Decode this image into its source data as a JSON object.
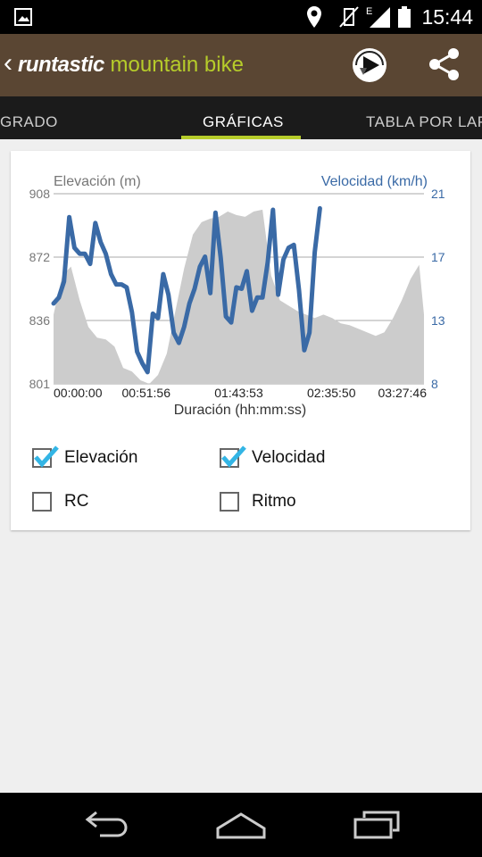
{
  "status_bar": {
    "time": "15:44",
    "icons": [
      "image-icon",
      "location-icon",
      "vibrate-off-icon",
      "signal-e-icon",
      "battery-icon"
    ]
  },
  "app_bar": {
    "back_glyph": "‹",
    "brand_part1": "runtastic",
    "brand_part2": "mountain bike",
    "actions": [
      "play-icon",
      "share-icon"
    ]
  },
  "tabs": [
    {
      "label": "GRADO"
    },
    {
      "label": "GRÁFICAS",
      "active": true
    },
    {
      "label": "TABLA POR LAP"
    }
  ],
  "chart_data": {
    "type": "area+line",
    "left_axis_title": "Elevación (m)",
    "right_axis_title": "Velocidad (km/h)",
    "x_axis_title": "Duración (hh:mm:ss)",
    "y_left_ticks": [
      "908",
      "872",
      "836",
      "801"
    ],
    "y_right_ticks": [
      "21",
      "17",
      "13",
      "8"
    ],
    "x_ticks": [
      "00:00:00",
      "00:51:56",
      "01:43:53",
      "02:35:50",
      "03:27:46"
    ],
    "y_left_range": [
      801,
      908
    ],
    "y_right_range": [
      8,
      21
    ],
    "x_range_minutes": [
      0,
      212.75
    ],
    "colors": {
      "elevation_fill": "#cccccc",
      "speed_line": "#3a6aa6",
      "left_axis_text": "#777777",
      "right_axis_text": "#3a6aa6"
    },
    "series": [
      {
        "name": "Elevación",
        "unit": "m",
        "x_min": [
          0,
          5,
          10,
          15,
          20,
          25,
          30,
          35,
          40,
          45,
          50,
          55,
          60,
          65,
          70,
          75,
          80,
          85,
          90,
          95,
          100,
          105,
          110,
          115,
          120,
          125,
          130,
          135,
          140,
          145,
          150,
          155,
          160,
          165,
          170,
          175,
          180,
          185,
          190,
          195,
          200,
          205,
          210,
          212.75
        ],
        "values": [
          840,
          862,
          867,
          848,
          833,
          827,
          826,
          822,
          810,
          808,
          803,
          801,
          806,
          818,
          842,
          866,
          885,
          892,
          894,
          895,
          898,
          896,
          895,
          898,
          899,
          862,
          848,
          845,
          842,
          840,
          838,
          840,
          838,
          835,
          834,
          832,
          830,
          828,
          830,
          838,
          848,
          860,
          868,
          840
        ]
      },
      {
        "name": "Velocidad",
        "unit": "km/h",
        "x_min": [
          0,
          3,
          6,
          9,
          12,
          15,
          18,
          21,
          24,
          27,
          30,
          33,
          36,
          39,
          42,
          45,
          48,
          51,
          54,
          57,
          60,
          63,
          66,
          69,
          72,
          75,
          78,
          81,
          84,
          87,
          90,
          93,
          96,
          99,
          102,
          105,
          108,
          111,
          114,
          117,
          120,
          123,
          126,
          129,
          132,
          135,
          138,
          141,
          144,
          147,
          150,
          153,
          156,
          159,
          162,
          165,
          168,
          171,
          174,
          177,
          180,
          183,
          186,
          189,
          192,
          195,
          198,
          201,
          204,
          207,
          210,
          212.75
        ],
        "values": [
          13.5,
          13.9,
          15.0,
          19.4,
          17.3,
          16.9,
          16.9,
          16.2,
          19.0,
          17.7,
          16.9,
          15.5,
          14.8,
          14.8,
          14.6,
          12.9,
          10.2,
          9.4,
          8.8,
          12.8,
          12.5,
          15.5,
          14.1,
          11.5,
          10.8,
          11.9,
          13.5,
          14.5,
          16.0,
          16.7,
          14.2,
          19.7,
          16.6,
          12.6,
          12.2,
          14.6,
          14.5,
          15.7,
          13.0,
          13.9,
          13.9,
          16.3,
          19.9,
          14.1,
          16.5,
          17.3,
          17.5,
          14.4,
          10.3,
          11.5,
          17.0,
          20.0
        ]
      }
    ],
    "legend_checkboxes": [
      {
        "label": "Elevación",
        "checked": true
      },
      {
        "label": "Velocidad",
        "checked": true
      },
      {
        "label": "RC",
        "checked": false
      },
      {
        "label": "Ritmo",
        "checked": false
      }
    ]
  },
  "nav_bar": {
    "buttons": [
      "back-nav-icon",
      "home-nav-icon",
      "recents-nav-icon"
    ]
  }
}
